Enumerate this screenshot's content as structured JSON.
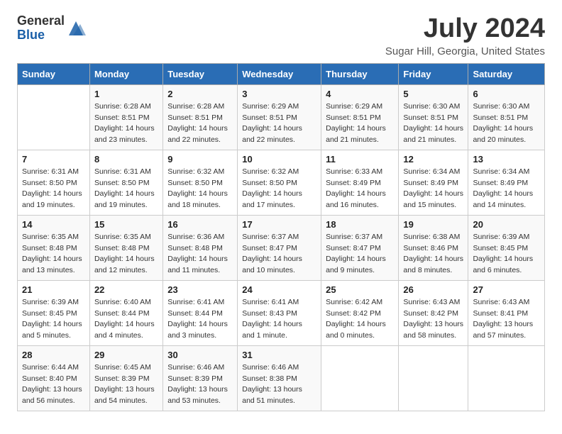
{
  "logo": {
    "general": "General",
    "blue": "Blue"
  },
  "title": "July 2024",
  "subtitle": "Sugar Hill, Georgia, United States",
  "headers": [
    "Sunday",
    "Monday",
    "Tuesday",
    "Wednesday",
    "Thursday",
    "Friday",
    "Saturday"
  ],
  "weeks": [
    [
      {
        "num": "",
        "sunrise": "",
        "sunset": "",
        "daylight": ""
      },
      {
        "num": "1",
        "sunrise": "Sunrise: 6:28 AM",
        "sunset": "Sunset: 8:51 PM",
        "daylight": "Daylight: 14 hours and 23 minutes."
      },
      {
        "num": "2",
        "sunrise": "Sunrise: 6:28 AM",
        "sunset": "Sunset: 8:51 PM",
        "daylight": "Daylight: 14 hours and 22 minutes."
      },
      {
        "num": "3",
        "sunrise": "Sunrise: 6:29 AM",
        "sunset": "Sunset: 8:51 PM",
        "daylight": "Daylight: 14 hours and 22 minutes."
      },
      {
        "num": "4",
        "sunrise": "Sunrise: 6:29 AM",
        "sunset": "Sunset: 8:51 PM",
        "daylight": "Daylight: 14 hours and 21 minutes."
      },
      {
        "num": "5",
        "sunrise": "Sunrise: 6:30 AM",
        "sunset": "Sunset: 8:51 PM",
        "daylight": "Daylight: 14 hours and 21 minutes."
      },
      {
        "num": "6",
        "sunrise": "Sunrise: 6:30 AM",
        "sunset": "Sunset: 8:51 PM",
        "daylight": "Daylight: 14 hours and 20 minutes."
      }
    ],
    [
      {
        "num": "7",
        "sunrise": "Sunrise: 6:31 AM",
        "sunset": "Sunset: 8:50 PM",
        "daylight": "Daylight: 14 hours and 19 minutes."
      },
      {
        "num": "8",
        "sunrise": "Sunrise: 6:31 AM",
        "sunset": "Sunset: 8:50 PM",
        "daylight": "Daylight: 14 hours and 19 minutes."
      },
      {
        "num": "9",
        "sunrise": "Sunrise: 6:32 AM",
        "sunset": "Sunset: 8:50 PM",
        "daylight": "Daylight: 14 hours and 18 minutes."
      },
      {
        "num": "10",
        "sunrise": "Sunrise: 6:32 AM",
        "sunset": "Sunset: 8:50 PM",
        "daylight": "Daylight: 14 hours and 17 minutes."
      },
      {
        "num": "11",
        "sunrise": "Sunrise: 6:33 AM",
        "sunset": "Sunset: 8:49 PM",
        "daylight": "Daylight: 14 hours and 16 minutes."
      },
      {
        "num": "12",
        "sunrise": "Sunrise: 6:34 AM",
        "sunset": "Sunset: 8:49 PM",
        "daylight": "Daylight: 14 hours and 15 minutes."
      },
      {
        "num": "13",
        "sunrise": "Sunrise: 6:34 AM",
        "sunset": "Sunset: 8:49 PM",
        "daylight": "Daylight: 14 hours and 14 minutes."
      }
    ],
    [
      {
        "num": "14",
        "sunrise": "Sunrise: 6:35 AM",
        "sunset": "Sunset: 8:48 PM",
        "daylight": "Daylight: 14 hours and 13 minutes."
      },
      {
        "num": "15",
        "sunrise": "Sunrise: 6:35 AM",
        "sunset": "Sunset: 8:48 PM",
        "daylight": "Daylight: 14 hours and 12 minutes."
      },
      {
        "num": "16",
        "sunrise": "Sunrise: 6:36 AM",
        "sunset": "Sunset: 8:48 PM",
        "daylight": "Daylight: 14 hours and 11 minutes."
      },
      {
        "num": "17",
        "sunrise": "Sunrise: 6:37 AM",
        "sunset": "Sunset: 8:47 PM",
        "daylight": "Daylight: 14 hours and 10 minutes."
      },
      {
        "num": "18",
        "sunrise": "Sunrise: 6:37 AM",
        "sunset": "Sunset: 8:47 PM",
        "daylight": "Daylight: 14 hours and 9 minutes."
      },
      {
        "num": "19",
        "sunrise": "Sunrise: 6:38 AM",
        "sunset": "Sunset: 8:46 PM",
        "daylight": "Daylight: 14 hours and 8 minutes."
      },
      {
        "num": "20",
        "sunrise": "Sunrise: 6:39 AM",
        "sunset": "Sunset: 8:45 PM",
        "daylight": "Daylight: 14 hours and 6 minutes."
      }
    ],
    [
      {
        "num": "21",
        "sunrise": "Sunrise: 6:39 AM",
        "sunset": "Sunset: 8:45 PM",
        "daylight": "Daylight: 14 hours and 5 minutes."
      },
      {
        "num": "22",
        "sunrise": "Sunrise: 6:40 AM",
        "sunset": "Sunset: 8:44 PM",
        "daylight": "Daylight: 14 hours and 4 minutes."
      },
      {
        "num": "23",
        "sunrise": "Sunrise: 6:41 AM",
        "sunset": "Sunset: 8:44 PM",
        "daylight": "Daylight: 14 hours and 3 minutes."
      },
      {
        "num": "24",
        "sunrise": "Sunrise: 6:41 AM",
        "sunset": "Sunset: 8:43 PM",
        "daylight": "Daylight: 14 hours and 1 minute."
      },
      {
        "num": "25",
        "sunrise": "Sunrise: 6:42 AM",
        "sunset": "Sunset: 8:42 PM",
        "daylight": "Daylight: 14 hours and 0 minutes."
      },
      {
        "num": "26",
        "sunrise": "Sunrise: 6:43 AM",
        "sunset": "Sunset: 8:42 PM",
        "daylight": "Daylight: 13 hours and 58 minutes."
      },
      {
        "num": "27",
        "sunrise": "Sunrise: 6:43 AM",
        "sunset": "Sunset: 8:41 PM",
        "daylight": "Daylight: 13 hours and 57 minutes."
      }
    ],
    [
      {
        "num": "28",
        "sunrise": "Sunrise: 6:44 AM",
        "sunset": "Sunset: 8:40 PM",
        "daylight": "Daylight: 13 hours and 56 minutes."
      },
      {
        "num": "29",
        "sunrise": "Sunrise: 6:45 AM",
        "sunset": "Sunset: 8:39 PM",
        "daylight": "Daylight: 13 hours and 54 minutes."
      },
      {
        "num": "30",
        "sunrise": "Sunrise: 6:46 AM",
        "sunset": "Sunset: 8:39 PM",
        "daylight": "Daylight: 13 hours and 53 minutes."
      },
      {
        "num": "31",
        "sunrise": "Sunrise: 6:46 AM",
        "sunset": "Sunset: 8:38 PM",
        "daylight": "Daylight: 13 hours and 51 minutes."
      },
      {
        "num": "",
        "sunrise": "",
        "sunset": "",
        "daylight": ""
      },
      {
        "num": "",
        "sunrise": "",
        "sunset": "",
        "daylight": ""
      },
      {
        "num": "",
        "sunrise": "",
        "sunset": "",
        "daylight": ""
      }
    ]
  ]
}
